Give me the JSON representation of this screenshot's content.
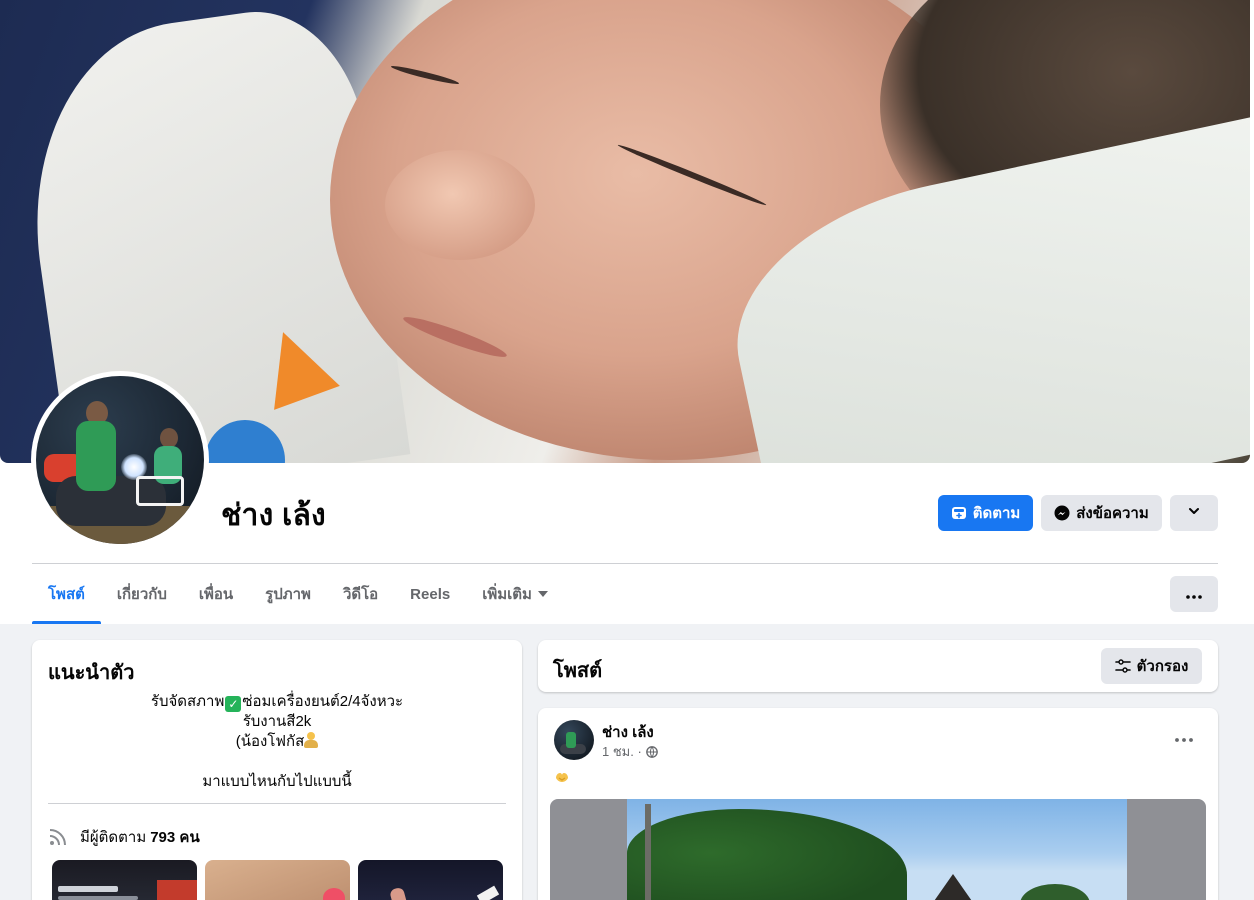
{
  "profile": {
    "name": "ช่าง เล้ง"
  },
  "actions": {
    "follow_label": "ติดตาม",
    "message_label": "ส่งข้อความ"
  },
  "tabs": [
    {
      "label": "โพสต์",
      "active": true
    },
    {
      "label": "เกี่ยวกับ",
      "active": false
    },
    {
      "label": "เพื่อน",
      "active": false
    },
    {
      "label": "รูปภาพ",
      "active": false
    },
    {
      "label": "วิดีโอ",
      "active": false
    },
    {
      "label": "Reels",
      "active": false
    },
    {
      "label": "เพิ่มเติม",
      "active": false
    }
  ],
  "intro": {
    "title": "แนะนำตัว",
    "bio_line1_a": "รับจัดสภาพ",
    "bio_line1_b": "ซ่อมเครื่องยนต์2/4จังหวะ",
    "bio_line2": "รับงานสี2k",
    "bio_line3": "(น้องโฟกัส",
    "bio_line4": "มาแบบไหนกับไปแบบนี้",
    "followers_prefix": "มีผู้ติดตาม",
    "followers_count": "793 คน"
  },
  "posts": {
    "title": "โพสต์",
    "filter_label": "ตัวกรอง",
    "items": [
      {
        "author": "ช่าง เล้ง",
        "time": "1 ชม. ·"
      }
    ]
  },
  "colors": {
    "accent": "#1877f2",
    "secondary_button": "#e4e6eb",
    "page_background": "#f0f2f5",
    "muted_text": "#65676b"
  }
}
